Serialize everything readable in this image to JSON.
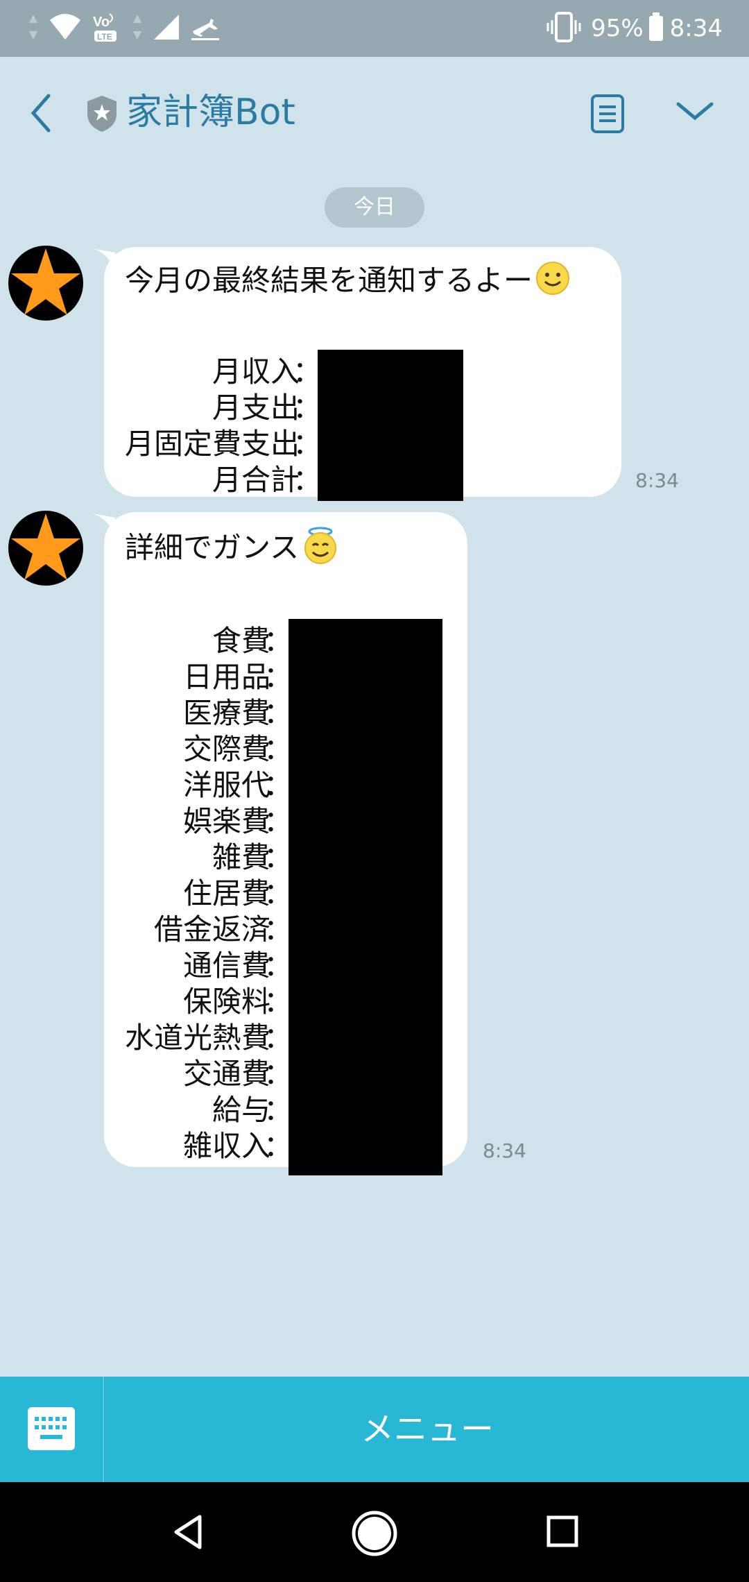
{
  "status_bar": {
    "battery": "95%",
    "time": "8:34",
    "icons": [
      "data-arrows-icon",
      "wifi-icon",
      "volte-icon",
      "signal-icon",
      "airplane-icon",
      "vibrate-icon",
      "battery-icon"
    ],
    "volte_label": "Vo",
    "lte_label": "LTE"
  },
  "header": {
    "title": "家計簿Bot",
    "icons": [
      "back-chevron-icon",
      "shield-star-icon",
      "notes-icon",
      "chevron-down-icon"
    ]
  },
  "date_divider": "今日",
  "messages": [
    {
      "text": "今月の最終結果を通知するよー",
      "emoji": "smiling-face-emoji",
      "rows": [
        {
          "label": "月収入"
        },
        {
          "label": "月支出"
        },
        {
          "label": "月固定費支出"
        },
        {
          "label": "月合計"
        }
      ],
      "colon": "：",
      "time": "8:34"
    },
    {
      "text": "詳細でガンス",
      "emoji": "angel-face-emoji",
      "rows": [
        {
          "label": "食費"
        },
        {
          "label": "日用品"
        },
        {
          "label": "医療費"
        },
        {
          "label": "交際費"
        },
        {
          "label": "洋服代"
        },
        {
          "label": "娯楽費"
        },
        {
          "label": "雑費"
        },
        {
          "label": "住居費"
        },
        {
          "label": "借金返済"
        },
        {
          "label": "通信費"
        },
        {
          "label": "保険料"
        },
        {
          "label": "水道光熱費"
        },
        {
          "label": "交通費"
        },
        {
          "label": "給与"
        },
        {
          "label": "雑収入"
        }
      ],
      "colon": "：",
      "time": "8:34"
    }
  ],
  "bottom_bar": {
    "menu_label": "メニュー",
    "keyboard_icon": "keyboard-icon"
  },
  "nav_bar": {
    "icons": [
      "nav-back-icon",
      "nav-home-icon",
      "nav-recent-icon"
    ]
  },
  "colors": {
    "status_bar_bg": "#97a9b0",
    "chat_bg": "#d1e3ea",
    "title_color": "#2b7ca4",
    "menu_bar_bg": "#29b7d6",
    "avatar_star": "#ff9a1a",
    "redaction": "#000000"
  }
}
